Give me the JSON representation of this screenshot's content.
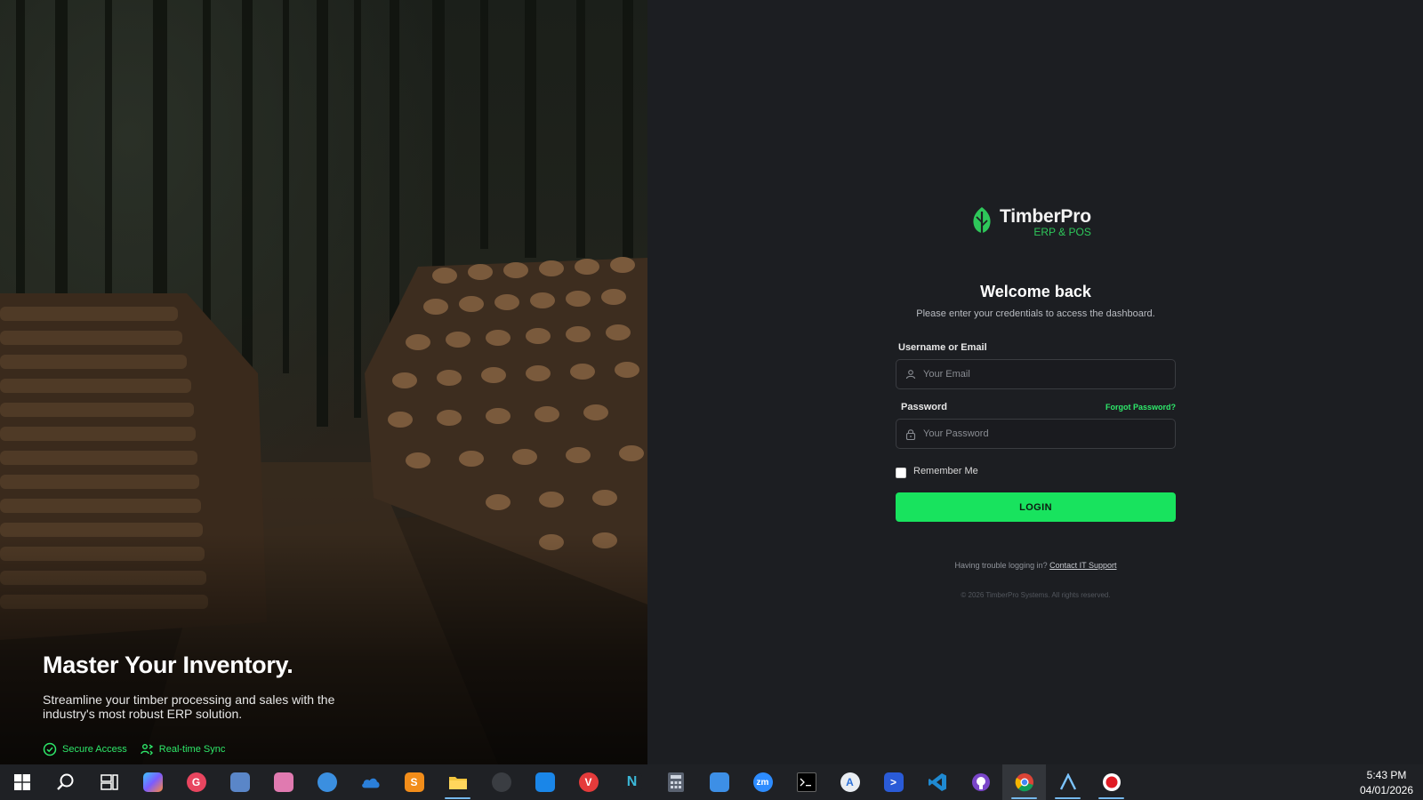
{
  "hero": {
    "title": "Master Your Inventory.",
    "subtitle": "Streamline your timber processing and sales with the industry's most robust ERP solution.",
    "badges": [
      {
        "label": "Secure Access",
        "icon": "shield-check-icon"
      },
      {
        "label": "Real-time Sync",
        "icon": "sync-users-icon"
      }
    ]
  },
  "brand": {
    "name": "TimberPro",
    "tagline": "ERP & POS",
    "accent": "#18e35e"
  },
  "login": {
    "title": "Welcome back",
    "subtitle": "Please enter your credentials to access the dashboard.",
    "username_label": "Username or Email",
    "username_placeholder": "Your Email",
    "password_label": "Password",
    "forgot_label": "Forgot Password?",
    "password_placeholder": "Your Password",
    "remember_label": "Remember Me",
    "remember_checked": false,
    "button_label": "LOGIN",
    "help_text": "Having trouble logging in?",
    "help_link": "Contact IT Support",
    "copyright": "© 2026 TimberPro Systems. All rights reserved."
  },
  "taskbar": {
    "icons": [
      {
        "name": "windows-start-icon",
        "glyph": "",
        "color": ""
      },
      {
        "name": "search-icon",
        "glyph": "",
        "color": ""
      },
      {
        "name": "task-view-icon",
        "glyph": "",
        "color": ""
      },
      {
        "name": "copilot-icon",
        "glyph": "",
        "color": "#7b5cff"
      },
      {
        "name": "app-g-icon",
        "glyph": "G",
        "color": "#e8455f"
      },
      {
        "name": "app-monitor-icon",
        "glyph": "",
        "color": "#5a86c8"
      },
      {
        "name": "app-cube-icon",
        "glyph": "",
        "color": "#e07ab0"
      },
      {
        "name": "sync-app-icon",
        "glyph": "",
        "color": "#3b8fe0"
      },
      {
        "name": "onedrive-icon",
        "glyph": "",
        "color": "#2b7fd9"
      },
      {
        "name": "sublime-text-icon",
        "glyph": "S",
        "color": "#f28d1a"
      },
      {
        "name": "file-explorer-icon",
        "glyph": "",
        "color": "#f2c53d"
      },
      {
        "name": "obs-icon",
        "glyph": "",
        "color": "#3a3d42"
      },
      {
        "name": "app-triangle-icon",
        "glyph": "",
        "color": "#1a86e8"
      },
      {
        "name": "vivaldi-icon",
        "glyph": "V",
        "color": "#e53b3b"
      },
      {
        "name": "app-n-icon",
        "glyph": "N",
        "color": "#1f2125"
      },
      {
        "name": "calculator-icon",
        "glyph": "",
        "color": "#5a6270"
      },
      {
        "name": "app-bird-icon",
        "glyph": "",
        "color": "#3d8fe6"
      },
      {
        "name": "zoom-icon",
        "glyph": "zm",
        "color": "#2d8cff"
      },
      {
        "name": "terminal-icon",
        "glyph": "",
        "color": "#111111"
      },
      {
        "name": "app-store-icon",
        "glyph": "A",
        "color": "#e9edf2"
      },
      {
        "name": "powershell-icon",
        "glyph": ">",
        "color": "#2a5bd7"
      },
      {
        "name": "vscode-icon",
        "glyph": "",
        "color": "#1f8ad2"
      },
      {
        "name": "github-icon",
        "glyph": "",
        "color": "#7a46c9"
      },
      {
        "name": "chrome-icon",
        "glyph": "",
        "color": "#e6e6e6"
      },
      {
        "name": "app-arrow-icon",
        "glyph": "",
        "color": "#1f2125"
      },
      {
        "name": "record-icon",
        "glyph": "",
        "color": "#ffffff"
      }
    ],
    "time": "5:43 PM",
    "date": "04/01/2026"
  }
}
